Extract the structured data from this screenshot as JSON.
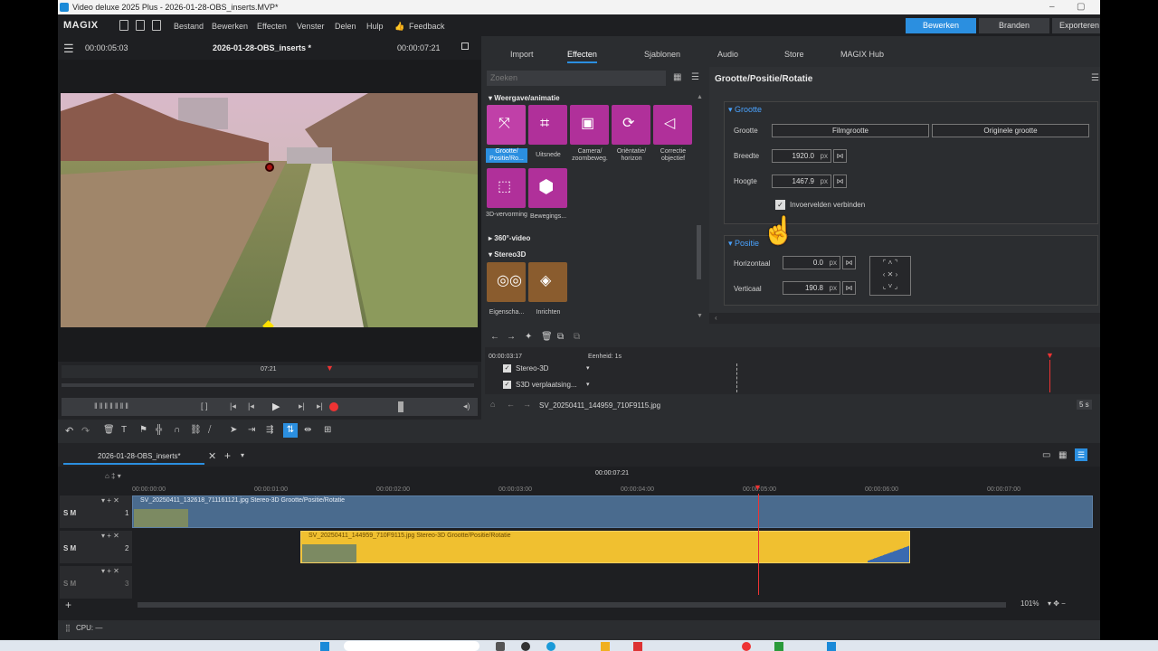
{
  "window": {
    "title": "Video deluxe 2025 Plus - 2026-01-28-OBS_inserts.MVP*"
  },
  "menubar": {
    "brand": "MAGIX",
    "items": [
      "Bestand",
      "Bewerken",
      "Effecten",
      "Venster",
      "Delen",
      "Hulp"
    ],
    "feedback": "Feedback"
  },
  "modes": {
    "edit": "Bewerken",
    "burn": "Branden",
    "export": "Exporteren"
  },
  "preview": {
    "timecode_left": "00:00:05:03",
    "project": "2026-01-28-OBS_inserts *",
    "timecode_right": "00:00:07:21",
    "scrub_time": "07:21"
  },
  "tabs": [
    "Import",
    "Effecten",
    "Sjablonen",
    "Audio",
    "Store",
    "MAGIX Hub"
  ],
  "search_placeholder": "Zoeken",
  "effects": {
    "category1": "Weergave/animatie",
    "tiles1": [
      "Grootte/ Positie/Ro...",
      "Uitsnede",
      "Camera/ zoombeweg.",
      "Oriëntatie/ horizon",
      "Correctie objectief"
    ],
    "tiles2": [
      "3D-vervorming",
      "Bewegings..."
    ],
    "category2": "360°-video",
    "category3": "Stereo3D",
    "tiles3": [
      "Eigenscha...",
      "Inrichten"
    ]
  },
  "props": {
    "title": "Grootte/Positie/Rotatie",
    "group1": "Grootte",
    "size_label": "Grootte",
    "film_size": "Filmgrootte",
    "orig_size": "Originele grootte",
    "width_label": "Breedte",
    "width_value": "1920.0",
    "height_label": "Hoogte",
    "height_value": "1467.9",
    "unit": "px",
    "link_label": "Invoervelden verbinden",
    "group2": "Positie",
    "h_label": "Horizontaal",
    "h_value": "0.0",
    "v_label": "Verticaal",
    "v_value": "190.8"
  },
  "keyframes": {
    "time": "00:00:03:17",
    "unit": "Eenheid: 1s",
    "rows": [
      "Stereo-3D",
      "S3D verplaatsing..."
    ],
    "file": "SV_20250411_144959_710F9115.jpg",
    "duration": "5 s"
  },
  "timeline": {
    "tab": "2026-01-28-OBS_inserts*",
    "cursor_time": "00:00:07:21",
    "ruler": [
      "00:00:00:00",
      "00:00:01:00",
      "00:00:02:00",
      "00:00:03:00",
      "00:00:04:00",
      "00:00:05:00",
      "00:00:06:00",
      "00:00:07:00"
    ],
    "clip1": "SV_20250411_132618_711161121.jpg   Stereo-3D   Grootte/Positie/Rotatie",
    "clip2": "SV_20250411_144959_710F9115.jpg   Stereo-3D   Grootte/Positie/Rotatie",
    "track_ctrl": "S M",
    "tracks": [
      "1",
      "2",
      "3"
    ],
    "zoom": "101%"
  },
  "status": {
    "cpu": "CPU: —"
  }
}
